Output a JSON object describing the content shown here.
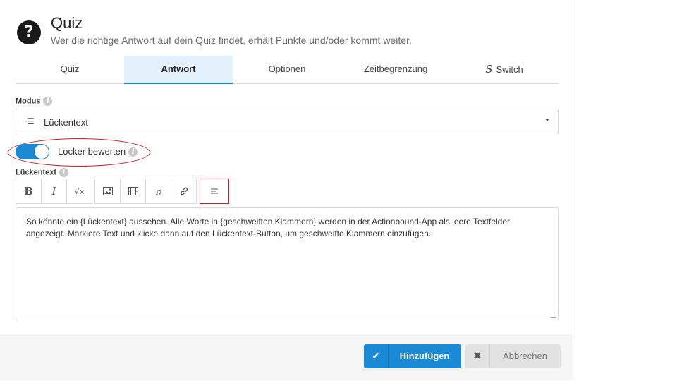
{
  "header": {
    "icon": "question-icon",
    "icon_glyph": "?",
    "title": "Quiz",
    "subtitle": "Wer die richtige Antwort auf dein Quiz findet, erhält Punkte und/oder kommt weiter."
  },
  "tabs": [
    {
      "label": "Quiz"
    },
    {
      "label": "Antwort",
      "active": true
    },
    {
      "label": "Optionen"
    },
    {
      "label": "Zeitbegrenzung"
    },
    {
      "label": "Switch",
      "icon": "switch-icon"
    }
  ],
  "modus": {
    "label": "Modus",
    "value": "Lückentext",
    "icon": "lines-icon"
  },
  "toggle": {
    "label": "Locker bewerten",
    "on": true
  },
  "editor": {
    "label": "Lückentext",
    "toolbar": [
      {
        "name": "bold",
        "glyph": "B"
      },
      {
        "name": "italic",
        "glyph": "I"
      },
      {
        "name": "formula",
        "glyph": "√x"
      },
      {
        "name": "image"
      },
      {
        "name": "video"
      },
      {
        "name": "audio",
        "glyph": "♫"
      },
      {
        "name": "link"
      },
      {
        "name": "cloze"
      }
    ],
    "text": "So könnte ein {Lückentext} aussehen. Alle Worte in {geschweiften Klammern} werden in der Actionbound-App als leere Textfelder angezeigt. Markiere Text und klicke dann auf den Lückentext-Button, um geschweifte Klammern einzufügen."
  },
  "footer": {
    "primary_label": "Hinzufügen",
    "primary_icon": "check-icon",
    "secondary_label": "Abbrechen",
    "secondary_icon": "close-icon"
  },
  "colors": {
    "accent": "#1a8ad6",
    "highlight": "#c8202a",
    "active_tab_bg": "#e3f1fc"
  }
}
